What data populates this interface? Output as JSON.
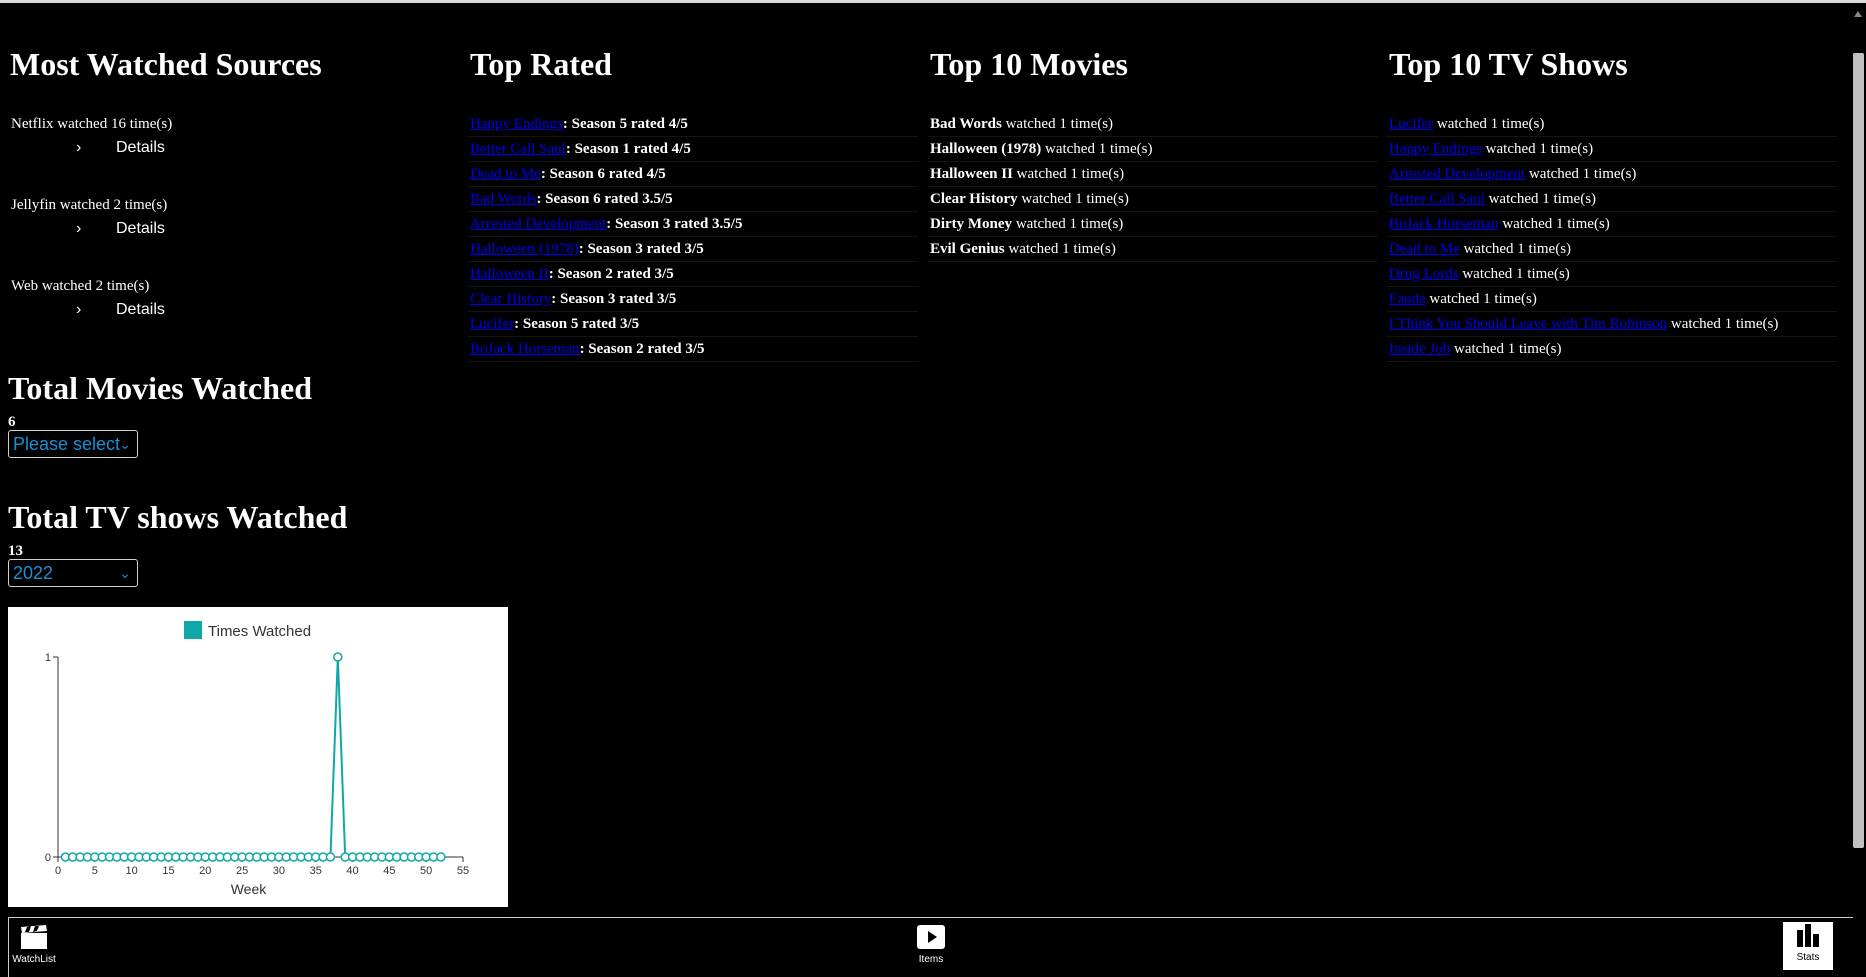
{
  "sources": {
    "title": "Most Watched Sources",
    "items": [
      {
        "text": "Netflix watched 16 time(s)",
        "details": "Details"
      },
      {
        "text": "Jellyfin watched 2 time(s)",
        "details": "Details"
      },
      {
        "text": "Web watched 2 time(s)",
        "details": "Details"
      }
    ]
  },
  "top_rated": {
    "title": "Top Rated",
    "items": [
      {
        "name": "Happy Endings",
        "info": ": Season 5 rated 4/5"
      },
      {
        "name": "Better Call Saul",
        "info": ": Season 1 rated 4/5"
      },
      {
        "name": "Dead to Me",
        "info": ": Season 6 rated 4/5"
      },
      {
        "name": "Bad Words",
        "info": ": Season 6 rated 3.5/5"
      },
      {
        "name": "Arrested Development",
        "info": ": Season 3 rated 3.5/5"
      },
      {
        "name": "Halloween (1978)",
        "info": ": Season 3 rated 3/5"
      },
      {
        "name": "Halloween II",
        "info": ": Season 2 rated 3/5"
      },
      {
        "name": "Clear History",
        "info": ": Season 3 rated 3/5"
      },
      {
        "name": "Lucifer",
        "info": ": Season 5 rated 3/5"
      },
      {
        "name": "BoJack Horseman",
        "info": ": Season 2 rated 3/5"
      }
    ]
  },
  "top_movies": {
    "title": "Top 10 Movies",
    "items": [
      {
        "name": "Bad Words",
        "info": " watched 1 time(s)"
      },
      {
        "name": "Halloween (1978)",
        "info": " watched 1 time(s)"
      },
      {
        "name": "Halloween II",
        "info": " watched 1 time(s)"
      },
      {
        "name": "Clear History",
        "info": " watched 1 time(s)"
      },
      {
        "name": "Dirty Money",
        "info": " watched 1 time(s)"
      },
      {
        "name": "Evil Genius",
        "info": " watched 1 time(s)"
      }
    ]
  },
  "top_tv": {
    "title": "Top 10 TV Shows",
    "items": [
      {
        "name": "Lucifer",
        "info": " watched 1 time(s)"
      },
      {
        "name": "Happy Endings",
        "info": " watched 1 time(s)"
      },
      {
        "name": "Arrested Development",
        "info": " watched 1 time(s)"
      },
      {
        "name": "Better Call Saul",
        "info": " watched 1 time(s)"
      },
      {
        "name": "BoJack Horseman",
        "info": " watched 1 time(s)"
      },
      {
        "name": "Dead to Me",
        "info": " watched 1 time(s)"
      },
      {
        "name": "Drug Lords",
        "info": " watched 1 time(s)"
      },
      {
        "name": "Fauda",
        "info": " watched 1 time(s)"
      },
      {
        "name": "I Think You Should Leave with Tim Robinson",
        "info": " watched 1 time(s)"
      },
      {
        "name": "Inside Job",
        "info": " watched 1 time(s)"
      }
    ]
  },
  "movies_total": {
    "title": "Total Movies Watched",
    "count": "6",
    "select_value": "Please select"
  },
  "tv_total": {
    "title": "Total TV shows Watched",
    "count": "13",
    "select_value": "2022"
  },
  "chart_data": {
    "type": "line",
    "legend": "Times Watched",
    "xlabel": "Week",
    "ylabel": "",
    "xlim": [
      0,
      55
    ],
    "ylim": [
      0,
      1
    ],
    "x_ticks": [
      0,
      5,
      10,
      15,
      20,
      25,
      30,
      35,
      40,
      45,
      50,
      55
    ],
    "y_ticks": [
      0,
      1
    ],
    "color": "#0fa8a8",
    "series": [
      {
        "name": "Times Watched",
        "x": [
          1,
          2,
          3,
          4,
          5,
          6,
          7,
          8,
          9,
          10,
          11,
          12,
          13,
          14,
          15,
          16,
          17,
          18,
          19,
          20,
          21,
          22,
          23,
          24,
          25,
          26,
          27,
          28,
          29,
          30,
          31,
          32,
          33,
          34,
          35,
          36,
          37,
          38,
          39,
          40,
          41,
          42,
          43,
          44,
          45,
          46,
          47,
          48,
          49,
          50,
          51,
          52
        ],
        "values": [
          0,
          0,
          0,
          0,
          0,
          0,
          0,
          0,
          0,
          0,
          0,
          0,
          0,
          0,
          0,
          0,
          0,
          0,
          0,
          0,
          0,
          0,
          0,
          0,
          0,
          0,
          0,
          0,
          0,
          0,
          0,
          0,
          0,
          0,
          0,
          0,
          0,
          1,
          0,
          0,
          0,
          0,
          0,
          0,
          0,
          0,
          0,
          0,
          0,
          0,
          0,
          0
        ]
      }
    ]
  },
  "nav": {
    "watchlist": "WatchList",
    "items": "Items",
    "stats": "Stats"
  },
  "colors": {
    "accent": "#0fa8a8",
    "link": "#0000ee",
    "select_text": "#1a8fd6"
  }
}
